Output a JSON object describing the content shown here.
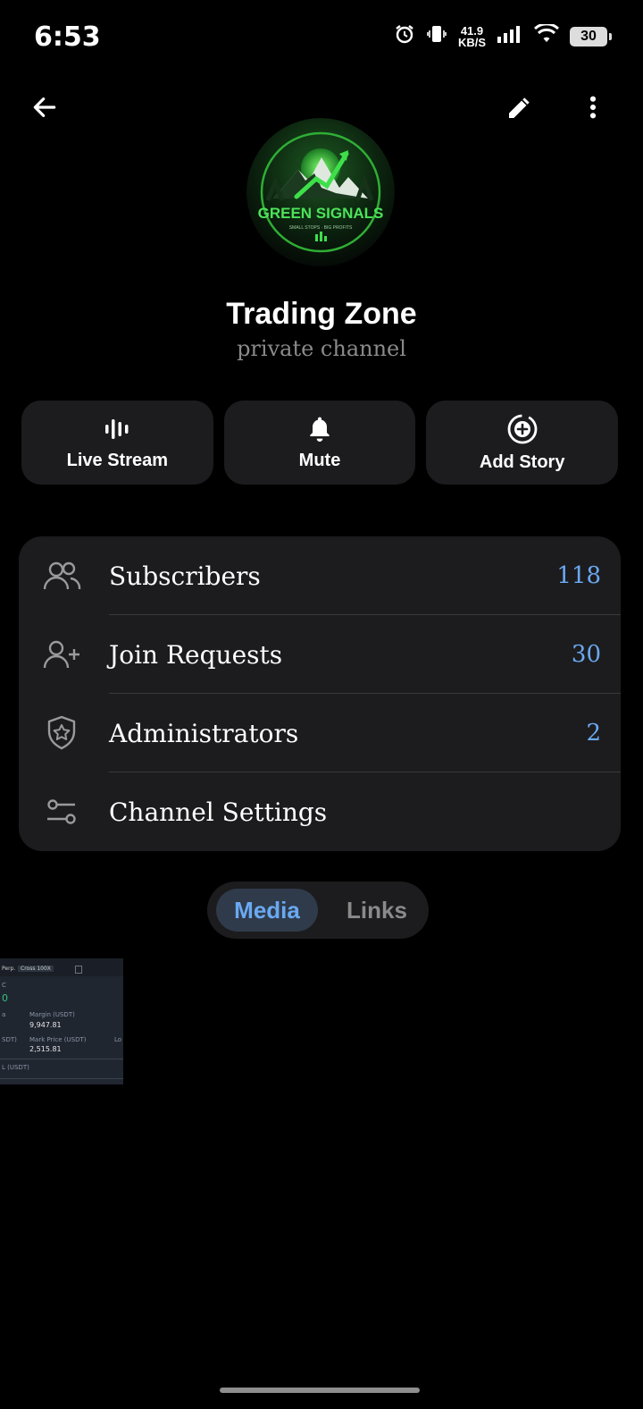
{
  "status_bar": {
    "time": "6:53",
    "net_speed_value": "41.9",
    "net_speed_unit": "KB/S",
    "battery": "30"
  },
  "channel": {
    "name": "Trading Zone",
    "type": "private channel",
    "avatar_text": "GREEN SIGNALS",
    "avatar_tagline": "SMALL STOPS · BIG PROFITS"
  },
  "actions": [
    {
      "label": "Live Stream",
      "icon": "live-stream-icon"
    },
    {
      "label": "Mute",
      "icon": "bell-icon"
    },
    {
      "label": "Add Story",
      "icon": "add-story-icon"
    }
  ],
  "info_rows": [
    {
      "label": "Subscribers",
      "count": "118",
      "icon": "users-icon"
    },
    {
      "label": "Join Requests",
      "count": "30",
      "icon": "user-add-icon"
    },
    {
      "label": "Administrators",
      "count": "2",
      "icon": "shield-star-icon"
    },
    {
      "label": "Channel Settings",
      "count": "",
      "icon": "sliders-icon"
    }
  ],
  "tabs": {
    "active": "Media",
    "inactive": "Links"
  },
  "media_thumb": {
    "header_left": "Perp.",
    "header_mid": "Cross 100X",
    "margin_label": "Margin (USDT)",
    "margin_value": "9,947.81",
    "mark_label": "Mark Price (USDT)",
    "mark_value": "2,515.81",
    "left_frag_1": "C",
    "left_frag_2": "0",
    "left_frag_3": "a",
    "left_frag_4": "SDT)",
    "left_frag_5": "L (USDT)",
    "right_frag": "Lo"
  },
  "colors": {
    "accent": "#6aa9f2",
    "card": "#1c1c1e",
    "background": "#000000"
  }
}
